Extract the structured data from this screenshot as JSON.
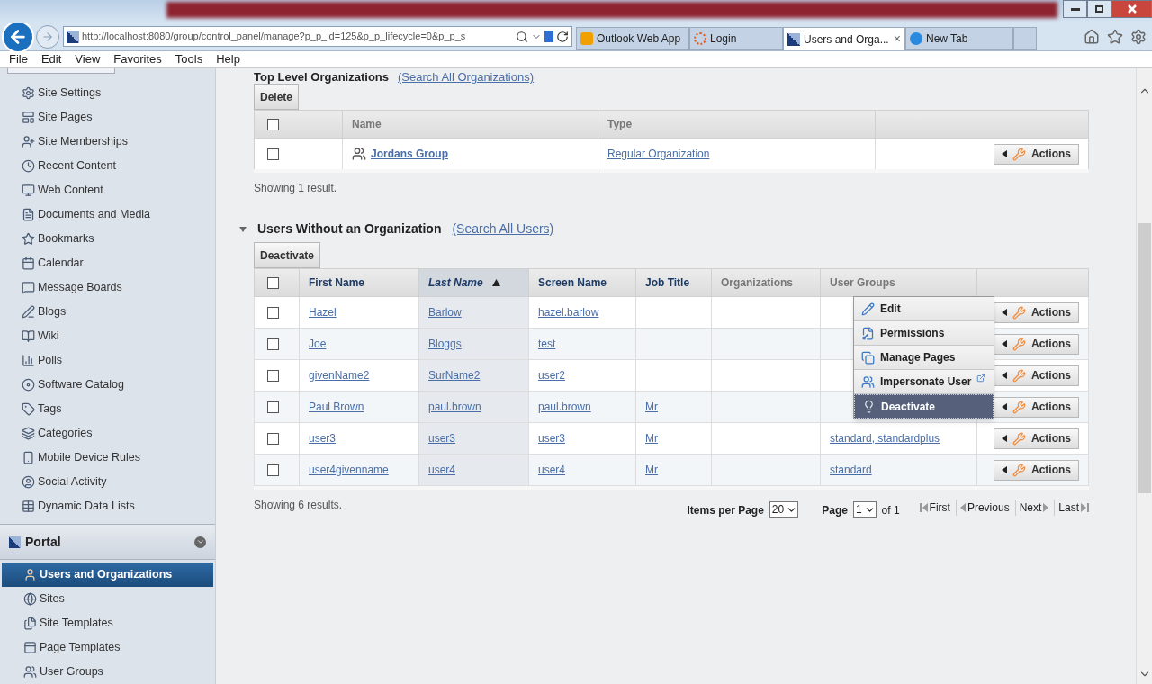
{
  "browser": {
    "address": "http://localhost:8080/group/control_panel/manage?p_p_id=125&p_p_lifecycle=0&p_p_s",
    "tabs": [
      {
        "label": "Outlook Web App",
        "selected": false
      },
      {
        "label": "Login",
        "selected": false
      },
      {
        "label": "Users and Orga...",
        "selected": true,
        "close": "×"
      },
      {
        "label": "New Tab",
        "selected": false
      }
    ],
    "menu": [
      "File",
      "Edit",
      "View",
      "Favorites",
      "Tools",
      "Help"
    ]
  },
  "sidebar": {
    "items": [
      "Site Settings",
      "Site Pages",
      "Site Memberships",
      "Recent Content",
      "Web Content",
      "Documents and Media",
      "Bookmarks",
      "Calendar",
      "Message Boards",
      "Blogs",
      "Wiki",
      "Polls",
      "Software Catalog",
      "Tags",
      "Categories",
      "Mobile Device Rules",
      "Social Activity",
      "Dynamic Data Lists"
    ],
    "portal": {
      "title": "Portal",
      "items": [
        {
          "label": "Users and Organizations",
          "selected": true
        },
        {
          "label": "Sites",
          "selected": false
        },
        {
          "label": "Site Templates",
          "selected": false
        },
        {
          "label": "Page Templates",
          "selected": false
        },
        {
          "label": "User Groups",
          "selected": false
        }
      ]
    }
  },
  "organizations": {
    "title": "Top Level Organizations",
    "link": "(Search All Organizations)",
    "button": "Delete",
    "select_all_checked": false,
    "columns": [
      "Name",
      "Type"
    ],
    "rows": [
      {
        "checked": false,
        "name": "Jordans Group",
        "type": "Regular Organization",
        "action": "Actions"
      }
    ],
    "summary": "Showing 1 result."
  },
  "users": {
    "title": "Users Without an Organization",
    "link": "(Search All Users)",
    "button": "Deactivate",
    "select_all_checked": false,
    "columns": [
      {
        "label": "First Name",
        "sorted": false,
        "dim": false
      },
      {
        "label": "Last Name",
        "sorted": true,
        "dim": false
      },
      {
        "label": "Screen Name",
        "sorted": false,
        "dim": false
      },
      {
        "label": "Job Title",
        "sorted": false,
        "dim": false
      },
      {
        "label": "Organizations",
        "sorted": false,
        "dim": true
      },
      {
        "label": "User Groups",
        "sorted": false,
        "dim": true
      }
    ],
    "rows": [
      {
        "checked": false,
        "cells": [
          "Hazel",
          "Barlow",
          "hazel.barlow",
          "",
          "",
          ""
        ],
        "action": "Actions"
      },
      {
        "checked": false,
        "cells": [
          "Joe",
          "Bloggs",
          "test",
          "",
          "",
          ""
        ],
        "action": "Actions"
      },
      {
        "checked": false,
        "cells": [
          "givenName2",
          "SurName2",
          "user2",
          "",
          "",
          ""
        ],
        "action": "Actions"
      },
      {
        "checked": false,
        "cells": [
          "Paul Brown",
          "paul.brown",
          "paul.brown",
          "Mr",
          "",
          ""
        ],
        "action": "Actions"
      },
      {
        "checked": false,
        "cells": [
          "user3",
          "user3",
          "user3",
          "Mr",
          "",
          "standard, standardplus"
        ],
        "action": "Actions"
      },
      {
        "checked": false,
        "cells": [
          "user4givenname",
          "user4",
          "user4",
          "Mr",
          "",
          "standard"
        ],
        "action": "Actions"
      }
    ],
    "summary": "Showing 6 results.",
    "pagination": {
      "items_label": "Items per Page",
      "items_value": "20",
      "page_label": "Page",
      "page_value": "1",
      "page_of": "of 1",
      "first": "First",
      "previous": "Previous",
      "next": "Next",
      "last": "Last"
    }
  },
  "action_menu": {
    "items": [
      {
        "label": "Edit",
        "selected": false
      },
      {
        "label": "Permissions",
        "selected": false
      },
      {
        "label": "Manage Pages",
        "selected": false
      },
      {
        "label": "Impersonate User",
        "selected": false,
        "external": true
      },
      {
        "label": "Deactivate",
        "selected": true
      }
    ]
  }
}
